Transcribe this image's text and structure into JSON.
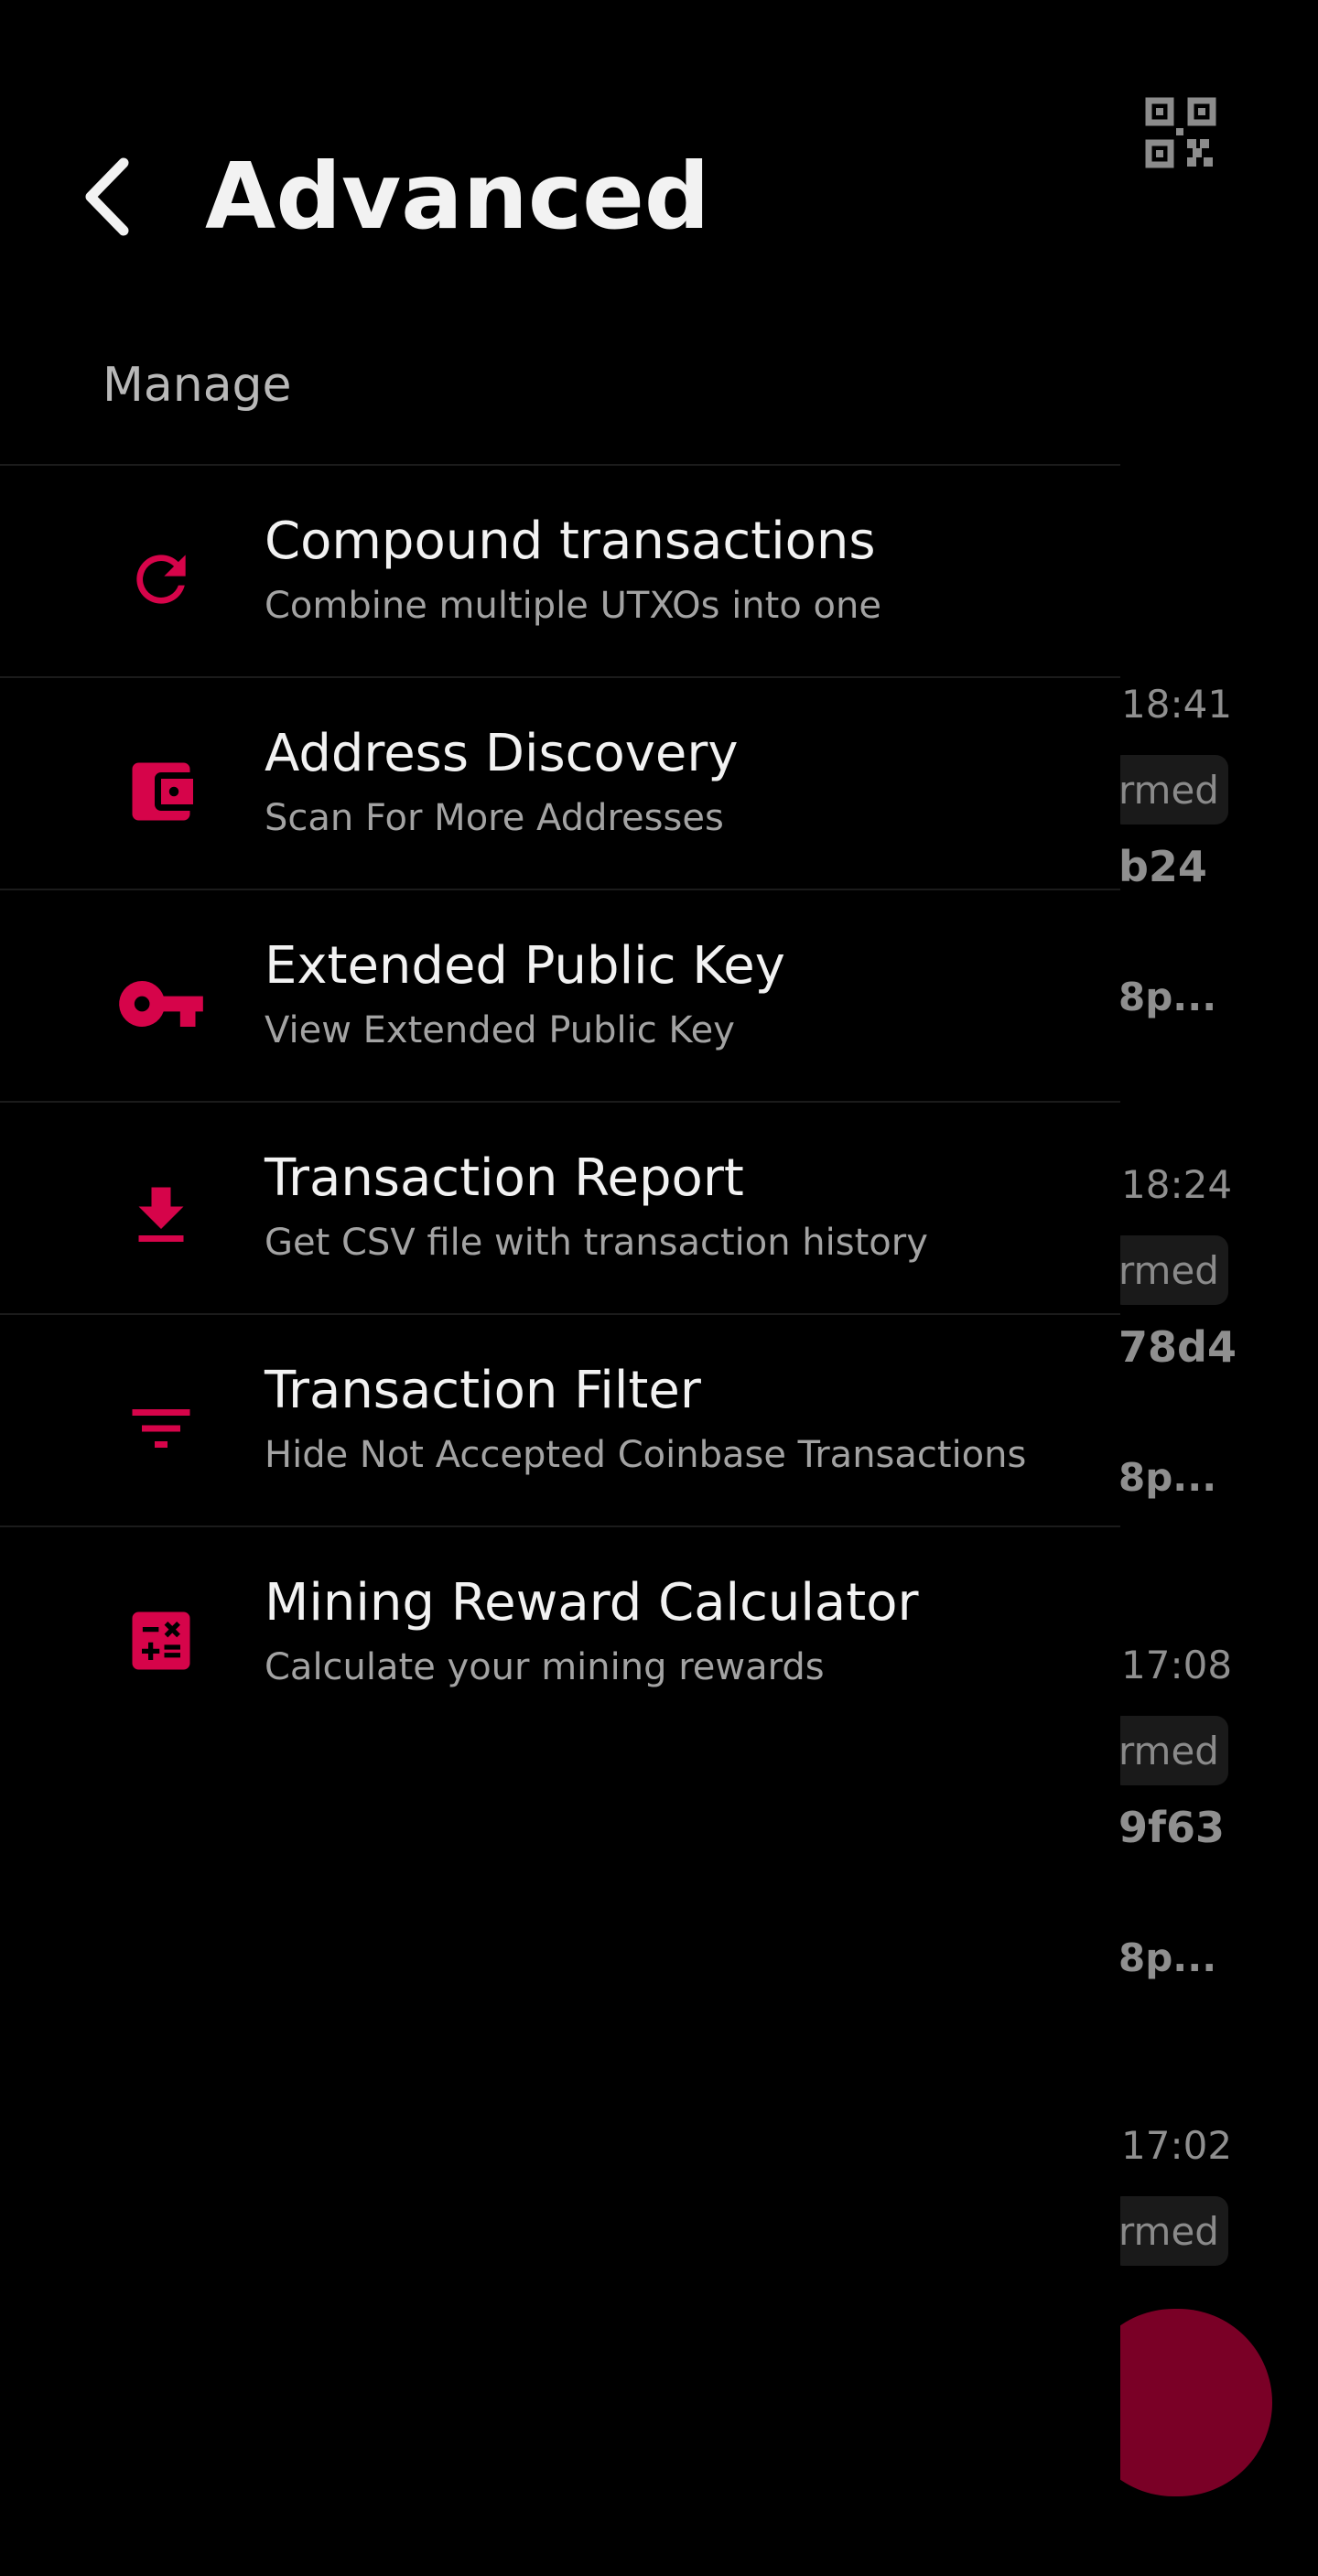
{
  "drawer": {
    "title": "Advanced",
    "section_label": "Manage",
    "items": [
      {
        "label": "Compound transactions",
        "description": "Combine multiple UTXOs into one",
        "icon": "refresh-icon"
      },
      {
        "label": "Address Discovery",
        "description": "Scan For More Addresses",
        "icon": "wallet-icon"
      },
      {
        "label": "Extended Public Key",
        "description": "View Extended Public Key",
        "icon": "key-icon"
      },
      {
        "label": "Transaction Report",
        "description": "Get CSV file with transaction history",
        "icon": "download-icon"
      },
      {
        "label": "Transaction Filter",
        "description": "Hide Not Accepted Coinbase Transactions",
        "icon": "filter-icon"
      },
      {
        "label": "Mining Reward Calculator",
        "description": "Calculate your mining rewards",
        "icon": "calculator-icon"
      }
    ]
  },
  "background": {
    "transactions": [
      {
        "time": "18:41",
        "status": "rmed",
        "hash": "b24",
        "address": "8p..."
      },
      {
        "time": "18:24",
        "status": "rmed",
        "hash": "78d4",
        "address": "8p..."
      },
      {
        "time": "17:08",
        "status": "rmed",
        "hash": "9f63",
        "address": "8p..."
      },
      {
        "time": "17:02",
        "status": "rmed"
      }
    ]
  },
  "colors": {
    "accent": "#d6044a",
    "background": "#000000",
    "text_primary": "#f2f2f2",
    "text_secondary": "#a3a3a3",
    "fab": "#7a0026"
  }
}
